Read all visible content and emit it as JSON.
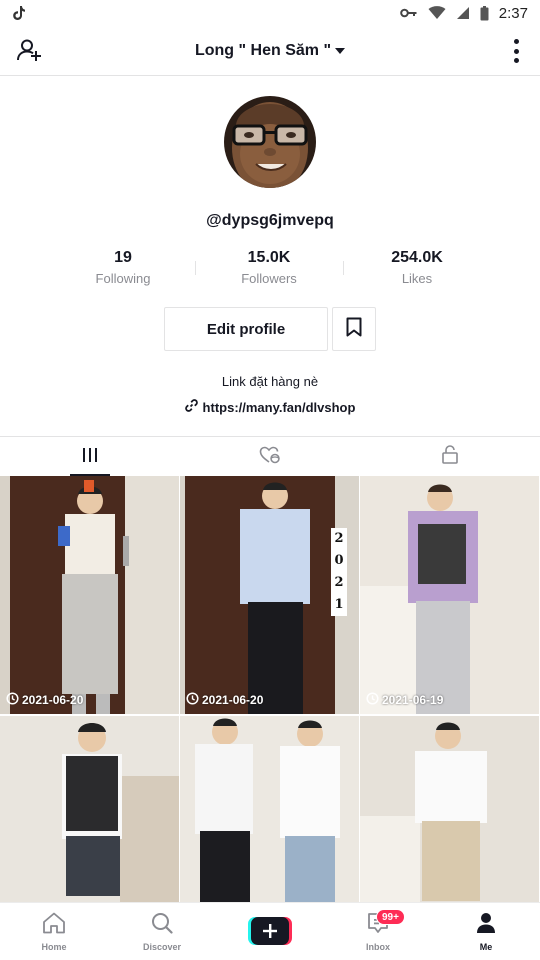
{
  "status_bar": {
    "time": "2:37",
    "icons": [
      "tiktok-icon",
      "key-icon",
      "wifi-icon",
      "signal-icon",
      "battery-icon"
    ]
  },
  "header": {
    "title": "Long \" Hen Săm \"",
    "left_icon": "add-user-icon",
    "right_icon": "more-vertical-icon"
  },
  "profile": {
    "username": "@dypsg6jmvepq",
    "stats": [
      {
        "value": "19",
        "label": "Following"
      },
      {
        "value": "15.0K",
        "label": "Followers"
      },
      {
        "value": "254.0K",
        "label": "Likes"
      }
    ],
    "edit_label": "Edit profile",
    "bio": "Link đặt hàng nè",
    "link": "https://many.fan/dlvshop"
  },
  "tabs": [
    {
      "icon": "videos-grid-icon",
      "active": true
    },
    {
      "icon": "liked-videos-icon",
      "active": false
    },
    {
      "icon": "private-lock-icon",
      "active": false
    }
  ],
  "videos": [
    {
      "date": "2021-06-20",
      "overlay": ""
    },
    {
      "date": "2021-06-20",
      "overlay": "2021"
    },
    {
      "date": "2021-06-19",
      "overlay": ""
    },
    {
      "date": "",
      "overlay": ""
    },
    {
      "date": "",
      "overlay": ""
    },
    {
      "date": "",
      "overlay": ""
    }
  ],
  "bottom_nav": {
    "items": [
      {
        "label": "Home",
        "icon": "home-icon"
      },
      {
        "label": "Discover",
        "icon": "search-icon"
      },
      {
        "label": "",
        "icon": "create-plus-icon"
      },
      {
        "label": "Inbox",
        "icon": "inbox-icon"
      },
      {
        "label": "Me",
        "icon": "profile-icon"
      }
    ],
    "inbox_badge": "99+"
  },
  "colors": {
    "accent": "#fe2c55",
    "cyan": "#25f4ee",
    "text": "#161823",
    "muted": "#8a8b91",
    "border": "#e3e3e4"
  }
}
